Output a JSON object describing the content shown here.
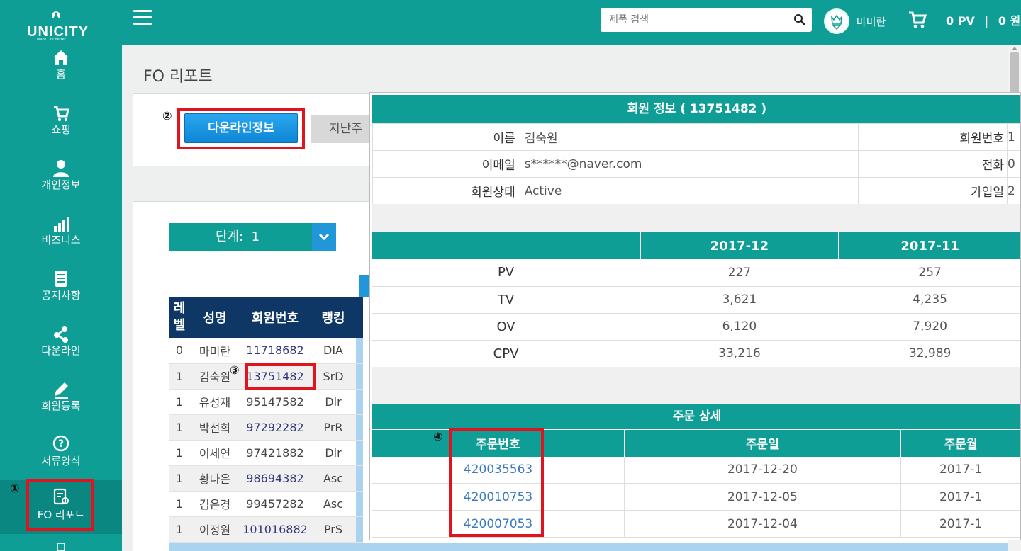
{
  "brand": {
    "name": "UNICITY",
    "tagline": "Make Life Better"
  },
  "sidebar": {
    "items": [
      {
        "label": "홈",
        "icon": "home-icon"
      },
      {
        "label": "쇼핑",
        "icon": "cart-icon"
      },
      {
        "label": "개인정보",
        "icon": "user-icon"
      },
      {
        "label": "비즈니스",
        "icon": "chart-icon"
      },
      {
        "label": "공지사항",
        "icon": "notice-icon"
      },
      {
        "label": "다운라인",
        "icon": "share-icon"
      },
      {
        "label": "회원등록",
        "icon": "pencil-icon"
      },
      {
        "label": "서류양식",
        "icon": "question-icon"
      },
      {
        "label": "FO 리포트",
        "icon": "report-icon"
      }
    ]
  },
  "annotations": {
    "one": "①",
    "two": "②",
    "three": "③",
    "four": "④"
  },
  "topbar": {
    "search_placeholder": "제품 검색",
    "username": "마미란",
    "pv": "0 PV",
    "separator": "|",
    "won": "0 원"
  },
  "page": {
    "title": "FO 리포트",
    "downline_button": "다운라인정보",
    "last_week_button": "지난주",
    "level_label": "단계:",
    "level_value": "1"
  },
  "downline_table": {
    "headers": [
      "레\n벨",
      "성명",
      "회원번호",
      "랭킹"
    ],
    "rows": [
      {
        "level": "0",
        "name": "마미란",
        "id": "11718682",
        "rank": "DIA"
      },
      {
        "level": "1",
        "name": "김숙원",
        "id": "13751482",
        "rank": "SrD"
      },
      {
        "level": "1",
        "name": "유성재",
        "id": "95147582",
        "rank": "Dir"
      },
      {
        "level": "1",
        "name": "박선희",
        "id": "97292282",
        "rank": "PrR"
      },
      {
        "level": "1",
        "name": "이세연",
        "id": "97421882",
        "rank": "Dir"
      },
      {
        "level": "1",
        "name": "황나은",
        "id": "98694382",
        "rank": "Asc"
      },
      {
        "level": "1",
        "name": "김은경",
        "id": "99457282",
        "rank": "Asc"
      },
      {
        "level": "1",
        "name": "이정원",
        "id": "101016882",
        "rank": "PrS"
      }
    ]
  },
  "popup": {
    "title": "회원 정보 ( 13751482 )",
    "info": [
      {
        "k": "이름",
        "v": "김숙원",
        "k2": "회원번호",
        "v2": "1"
      },
      {
        "k": "이메일",
        "v": "s******@naver.com",
        "k2": "전화",
        "v2": "0"
      },
      {
        "k": "회원상태",
        "v": "Active",
        "k2": "가입일",
        "v2": "2"
      }
    ],
    "stats": {
      "months": [
        "2017-12",
        "2017-11"
      ],
      "rows": [
        {
          "label": "PV",
          "a": "227",
          "b": "257"
        },
        {
          "label": "TV",
          "a": "3,621",
          "b": "4,235"
        },
        {
          "label": "OV",
          "a": "6,120",
          "b": "7,920"
        },
        {
          "label": "CPV",
          "a": "33,216",
          "b": "32,989"
        }
      ]
    },
    "orders": {
      "title": "주문 상세",
      "headers": [
        "주문번호",
        "주문일",
        "주문월"
      ],
      "rows": [
        {
          "no": "420035563",
          "date": "2017-12-20",
          "month": "2017-1"
        },
        {
          "no": "420010753",
          "date": "2017-12-05",
          "month": "2017-1"
        },
        {
          "no": "420007053",
          "date": "2017-12-04",
          "month": "2017-1"
        }
      ]
    }
  }
}
